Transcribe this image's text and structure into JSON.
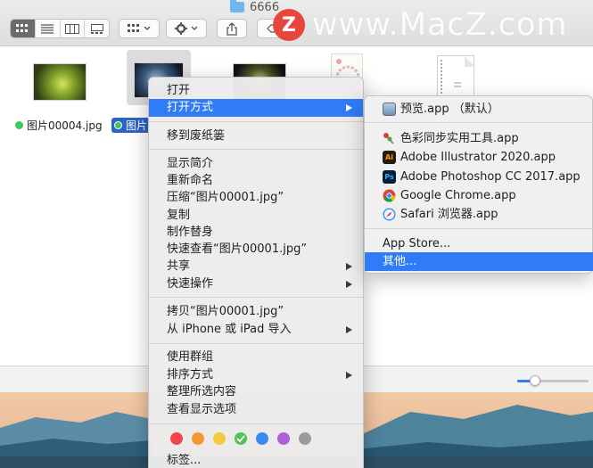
{
  "window": {
    "title": "6666"
  },
  "watermark": {
    "logo_letter": "Z",
    "text": "www.MacZ.com"
  },
  "toolbar": {
    "view_icons": [
      "icon-view-icon",
      "list-view-icon",
      "column-view-icon",
      "gallery-view-icon"
    ],
    "group_icon": "group-grid-icon",
    "action_icon": "gear-icon",
    "share_icon": "share-icon",
    "tag_icon": "tag-icon"
  },
  "files": [
    {
      "name": "图片00004.jpg",
      "tag_color": "#3ec75a",
      "selected": false
    },
    {
      "name": "图片",
      "tag_color": "#3ec75a",
      "selected": true
    }
  ],
  "context_menu": {
    "open": "打开",
    "open_with": "打开方式",
    "trash": "移到废纸篓",
    "get_info": "显示简介",
    "rename": "重新命名",
    "compress": "压缩“图片00001.jpg”",
    "duplicate": "复制",
    "make_alias": "制作替身",
    "quick_look": "快速查看“图片00001.jpg”",
    "share": "共享",
    "quick_actions": "快速操作",
    "copy": "拷贝“图片00001.jpg”",
    "import": "从 iPhone 或 iPad 导入",
    "use_groups": "使用群组",
    "sort_by": "排序方式",
    "clean_up": "整理所选内容",
    "view_options": "查看显示选项",
    "tags_label": "标签...",
    "tag_colors": [
      "#f0484a",
      "#f59a32",
      "#f4c93b",
      "#55c15a",
      "#3a8af0",
      "#b15fd6",
      "#9b9b9b"
    ]
  },
  "submenu": {
    "default_app": "预览.app （默认）",
    "apps": [
      {
        "name": "色彩同步实用工具.app",
        "icon": "colorsync-icon"
      },
      {
        "name": "Adobe Illustrator 2020.app",
        "icon": "illustrator-icon",
        "abbr": "Ai"
      },
      {
        "name": "Adobe Photoshop CC 2017.app",
        "icon": "photoshop-icon",
        "abbr": "Ps"
      },
      {
        "name": "Google Chrome.app",
        "icon": "chrome-icon"
      },
      {
        "name": "Safari 浏览器.app",
        "icon": "safari-icon"
      }
    ],
    "app_store": "App Store...",
    "other": "其他..."
  },
  "colors": {
    "accent": "#2f7cf6",
    "menu_bg": "#ececec"
  }
}
